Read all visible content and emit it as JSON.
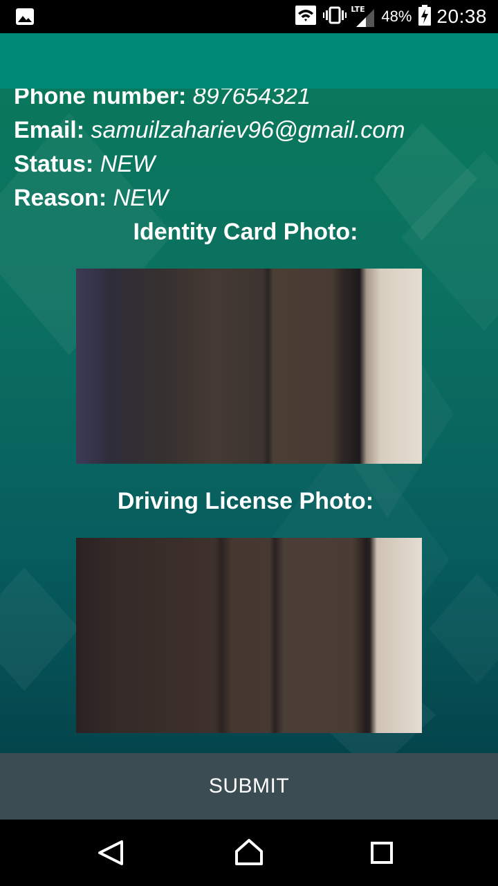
{
  "status_bar": {
    "network_type": "LTE",
    "battery_percent": "48%",
    "time": "20:38",
    "icons": [
      "image-notification-icon",
      "wifi-icon",
      "vibrate-icon",
      "cell-signal-icon",
      "battery-charging-icon"
    ]
  },
  "details": {
    "phone_label": "Phone number:",
    "phone_value": "897654321",
    "email_label": "Email:",
    "email_value": "samuilzahariev96@gmail.com",
    "status_label": "Status:",
    "status_value": "NEW",
    "reason_label": "Reason:",
    "reason_value": "NEW"
  },
  "photos": {
    "identity_title": "Identity Card Photo:",
    "license_title": "Driving License Photo:"
  },
  "actions": {
    "submit_label": "SUBMIT"
  },
  "navigation": {
    "icons": [
      "back-icon",
      "home-icon",
      "recents-icon"
    ]
  },
  "colors": {
    "toolbar": "#008a76",
    "background_top": "#0a7a5b",
    "background_bottom": "#033d46",
    "submit_button": "#3b4d52"
  }
}
